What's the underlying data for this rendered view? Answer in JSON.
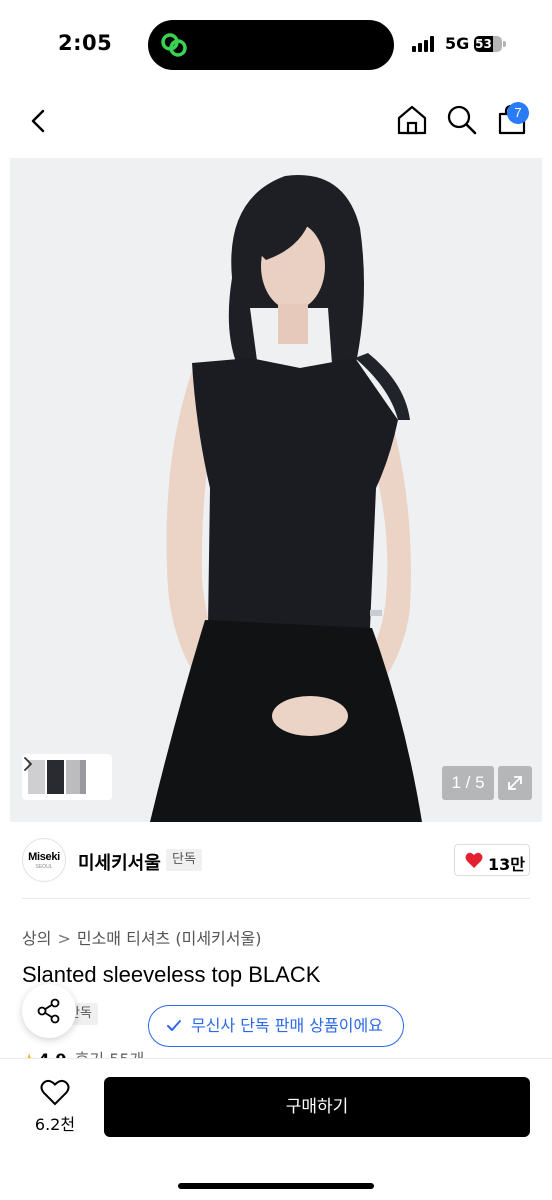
{
  "status_bar": {
    "time": "2:05",
    "network": "5G",
    "battery": "53",
    "app_icon": "link-rings-icon"
  },
  "nav": {
    "back_icon": "chevron-left-icon",
    "home_icon": "home-icon",
    "search_icon": "search-icon",
    "cart_icon": "shopping-bag-icon",
    "cart_count": "7"
  },
  "gallery": {
    "page_indicator": "1 / 5",
    "expand_icon": "expand-arrows-icon",
    "thumbnail_more_icon": "chevron-right-icon"
  },
  "brand": {
    "logo_text": "Miseki",
    "logo_sub": "SEOUL",
    "name": "미세키서울",
    "exclusive_tag": "단독",
    "like_count": "13만"
  },
  "product": {
    "breadcrumb": [
      "상의",
      "민소매 티셔츠 (미세키서울)"
    ],
    "breadcrumb_separator": ">",
    "title": "Slanted sleeveless top BLACK",
    "sub_tag": "단독",
    "rating": "4.9",
    "review_text": "후기 55개"
  },
  "exclusive_banner": {
    "text": "무신사 단독 판매 상품이에요"
  },
  "bottom_bar": {
    "wishlist_count": "6.2천",
    "buy_label": "구매하기"
  },
  "colors": {
    "accent_blue": "#2a69e8",
    "badge_blue": "#2a7cf6",
    "like_red": "#e5202e",
    "rating_star": "#f5b120"
  }
}
